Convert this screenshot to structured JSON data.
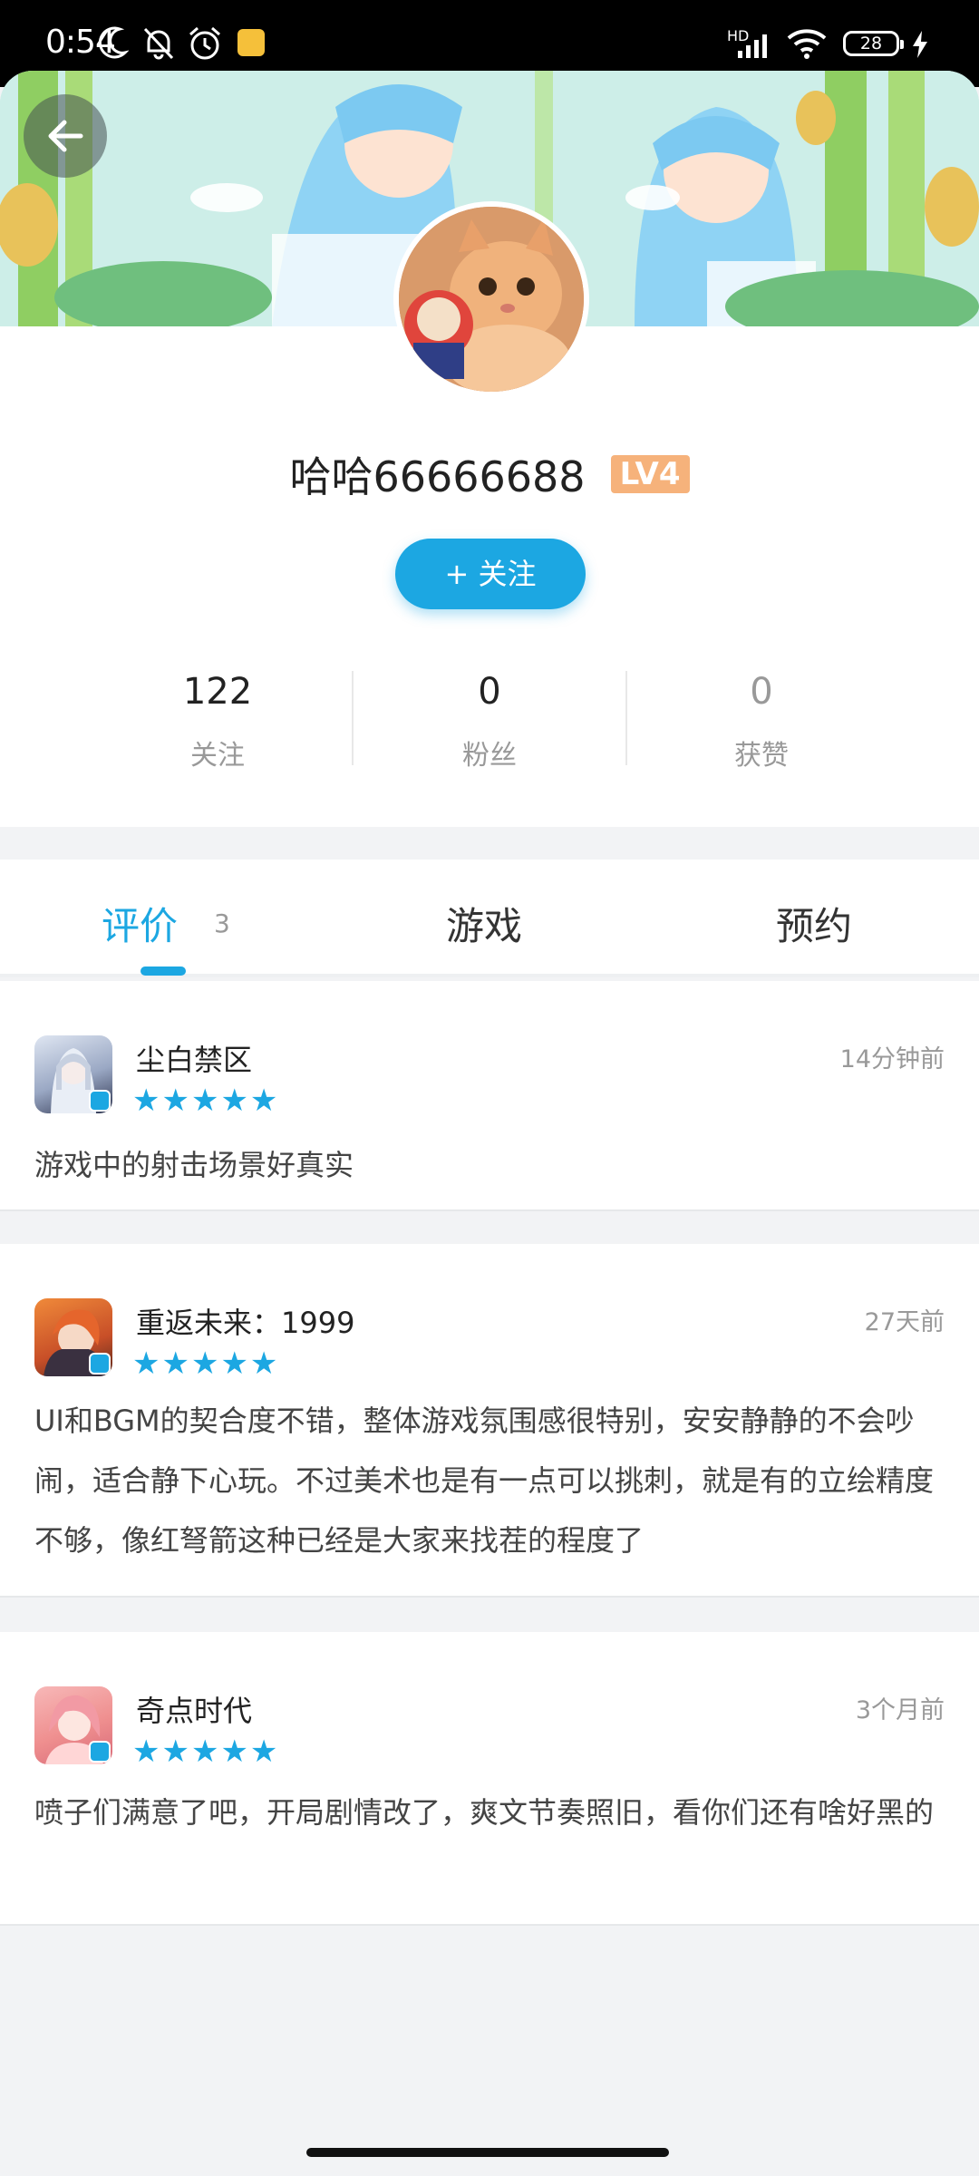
{
  "status_bar": {
    "time": "0:54",
    "battery": "28",
    "network": "HD"
  },
  "profile": {
    "username": "哈哈66666688",
    "level": "LV4",
    "follow_button": "+ 关注",
    "stats": [
      {
        "value": "122",
        "label": "关注"
      },
      {
        "value": "0",
        "label": "粉丝"
      },
      {
        "value": "0",
        "label": "获赞"
      }
    ]
  },
  "tabs": {
    "items": [
      "评价",
      "游戏",
      "预约"
    ],
    "review_count": "3",
    "active": "评价"
  },
  "reviews": [
    {
      "game": "尘白禁区",
      "rating": 5,
      "stars": "★★★★★",
      "time": "14分钟前",
      "text": "游戏中的射击场景好真实"
    },
    {
      "game": "重返未来：1999",
      "rating": 5,
      "stars": "★★★★★",
      "time": "27天前",
      "text": "UI和BGM的契合度不错，整体游戏氛围感很特别，安安静静的不会吵闹，适合静下心玩。不过美术也是有一点可以挑刺，就是有的立绘精度不够，像红弩箭这种已经是大家来找茬的程度了"
    },
    {
      "game": "奇点时代",
      "rating": 5,
      "stars": "★★★★★",
      "time": "3个月前",
      "text": "喷子们满意了吧，开局剧情改了，爽文节奏照旧，看你们还有啥好黑的"
    }
  ],
  "colors": {
    "accent": "#1ca7e2",
    "level_badge": "#f6b27b"
  },
  "icons": {
    "back": "arrow-left-icon",
    "star": "star-icon"
  }
}
